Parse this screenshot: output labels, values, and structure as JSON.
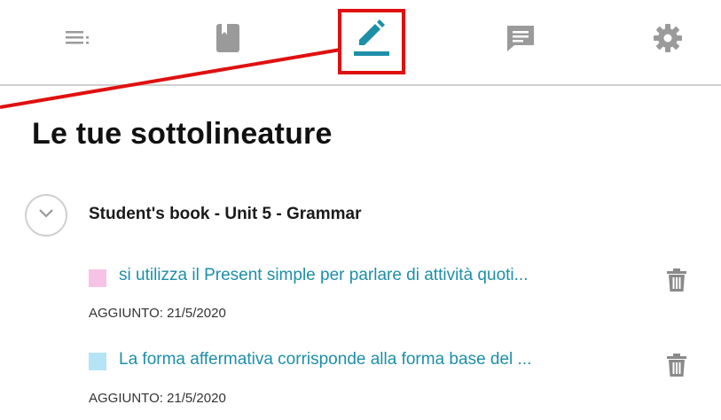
{
  "toolbar": {
    "icons": [
      "list-icon",
      "book-icon",
      "pencil-highlight-icon",
      "comment-icon",
      "gear-icon"
    ],
    "accent": "#1d8fa8",
    "annotation_color": "#e01010"
  },
  "page": {
    "title": "Le tue sottolineature"
  },
  "section": {
    "title": "Student's book - Unit 5 - Grammar"
  },
  "notes": [
    {
      "text": "si utilizza il Present simple per parlare di attività quoti...",
      "color": "#f6c3e6",
      "date": "AGGIUNTO: 21/5/2020"
    },
    {
      "text": "La forma affermativa corrisponde alla forma base del ...",
      "color": "#b4e4f5",
      "date": "AGGIUNTO: 21/5/2020"
    }
  ]
}
